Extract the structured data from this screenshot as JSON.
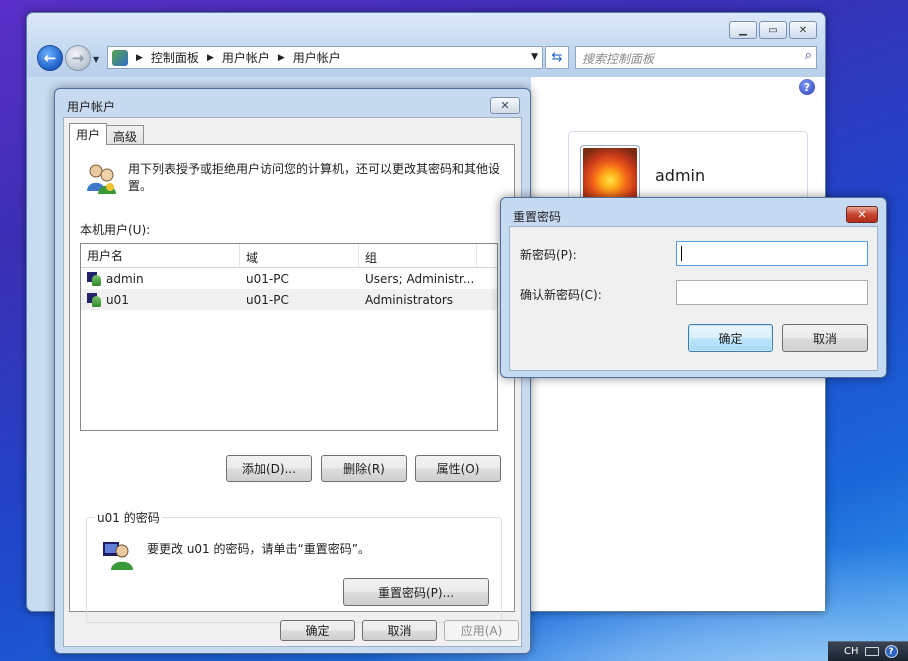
{
  "explorer": {
    "breadcrumb": [
      "控制面板",
      "用户帐户",
      "用户帐户"
    ],
    "search_placeholder": "搜索控制面板",
    "user_card_name": "admin"
  },
  "user_accounts_dialog": {
    "title": "用户帐户",
    "tabs": [
      "用户",
      "高级"
    ],
    "intro": "用下列表授予或拒绝用户访问您的计算机，还可以更改其密码和其他设置。",
    "local_users_label": "本机用户(U):",
    "columns": [
      "用户名",
      "域",
      "组"
    ],
    "rows": [
      {
        "user": "admin",
        "domain": "u01-PC",
        "group": "Users; Administr..."
      },
      {
        "user": "u01",
        "domain": "u01-PC",
        "group": "Administrators"
      }
    ],
    "buttons": {
      "add": "添加(D)...",
      "remove": "删除(R)",
      "properties": "属性(O)"
    },
    "password_group": {
      "label": "u01 的密码",
      "text": "要更改 u01 的密码，请单击“重置密码”。",
      "reset_button": "重置密码(P)..."
    },
    "footer": {
      "ok": "确定",
      "cancel": "取消",
      "apply": "应用(A)"
    }
  },
  "reset_dialog": {
    "title": "重置密码",
    "new_password_label": "新密码(P):",
    "confirm_password_label": "确认新密码(C):",
    "ok": "确定",
    "cancel": "取消"
  },
  "tray": {
    "lang": "CH"
  }
}
